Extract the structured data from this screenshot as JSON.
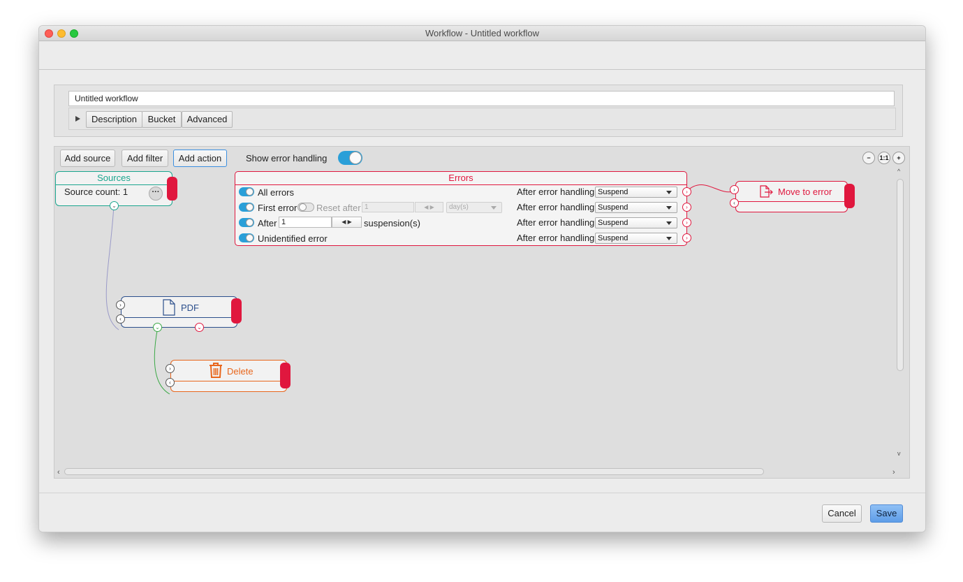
{
  "window": {
    "title": "Workflow - Untitled workflow"
  },
  "header": {
    "name_value": "Untitled workflow",
    "tabs": [
      "Description",
      "Bucket",
      "Advanced"
    ]
  },
  "toolbar": {
    "add_source": "Add source",
    "add_filter": "Add filter",
    "add_action": "Add action",
    "show_error_label": "Show error handling",
    "zoom_reset": "1:1"
  },
  "sources": {
    "title": "Sources",
    "count_label": "Source count: 1",
    "more": "···"
  },
  "errors": {
    "title": "Errors",
    "rows": [
      {
        "label": "All errors",
        "after": "After error handling",
        "action": "Suspend"
      },
      {
        "label": "First error",
        "reset_label": "Reset after",
        "reset_value": "1",
        "reset_unit": "day(s)",
        "after": "After error handling",
        "action": "Suspend"
      },
      {
        "label": "After",
        "value": "1",
        "suffix": "suspension(s)",
        "after": "After error handling",
        "action": "Suspend"
      },
      {
        "label": "Unidentified error",
        "after": "After error handling",
        "action": "Suspend"
      }
    ]
  },
  "nodes": {
    "move_to_error": "Move to error",
    "pdf": "PDF",
    "delete": "Delete"
  },
  "footer": {
    "cancel": "Cancel",
    "save": "Save"
  },
  "colors": {
    "accent": "#2a9fd8",
    "error": "#e0173e",
    "source": "#1aa58e",
    "delete": "#e8661c",
    "pdf": "#2c4f8c"
  }
}
